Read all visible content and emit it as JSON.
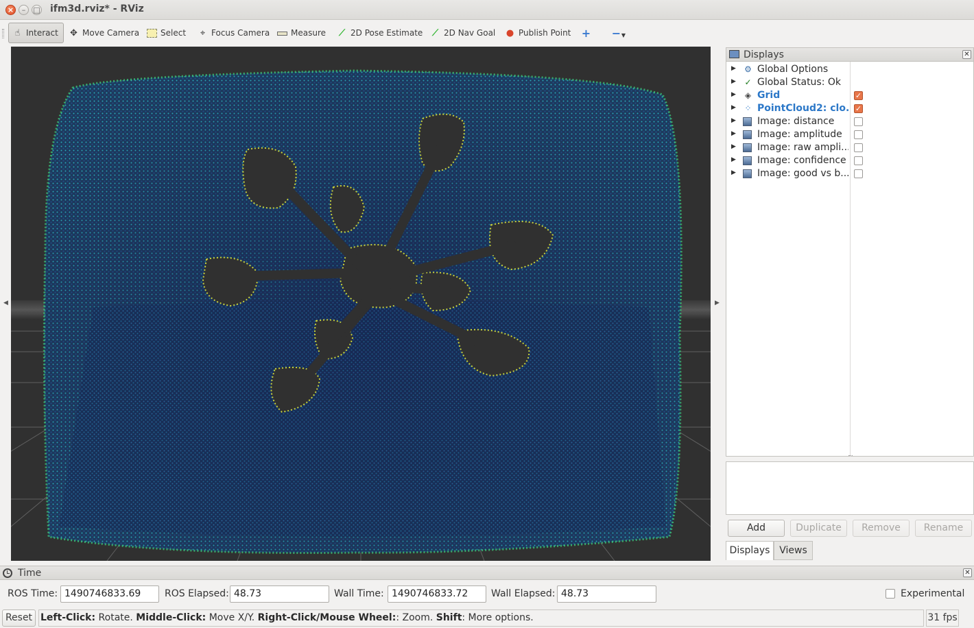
{
  "window": {
    "title": "ifm3d.rviz* - RViz"
  },
  "toolbar": {
    "interact": "Interact",
    "move_camera": "Move Camera",
    "select": "Select",
    "focus_camera": "Focus Camera",
    "measure": "Measure",
    "pose_estimate": "2D Pose Estimate",
    "nav_goal": "2D Nav Goal",
    "publish_point": "Publish Point"
  },
  "displays": {
    "title": "Displays",
    "items": [
      {
        "label": "Global Options",
        "icon": "gear-icon",
        "checked": null
      },
      {
        "label": "Global Status: Ok",
        "icon": "check-icon",
        "checked": null
      },
      {
        "label": "Grid",
        "icon": "grid-icon",
        "checked": true,
        "highlight": true
      },
      {
        "label": "PointCloud2: clo...",
        "icon": "pointcloud-icon",
        "checked": true,
        "highlight": true
      },
      {
        "label": "Image: distance",
        "icon": "image-icon",
        "checked": false
      },
      {
        "label": "Image: amplitude",
        "icon": "image-icon",
        "checked": false
      },
      {
        "label": "Image: raw ampli...",
        "icon": "image-icon",
        "checked": false
      },
      {
        "label": "Image: confidence",
        "icon": "image-icon",
        "checked": false
      },
      {
        "label": "Image: good vs b...",
        "icon": "image-icon",
        "checked": false
      }
    ],
    "buttons": {
      "add": "Add",
      "duplicate": "Duplicate",
      "remove": "Remove",
      "rename": "Rename"
    },
    "tabs": {
      "displays": "Displays",
      "views": "Views"
    }
  },
  "time": {
    "title": "Time",
    "ros_time_label": "ROS Time:",
    "ros_time": "1490746833.69",
    "ros_elapsed_label": "ROS Elapsed:",
    "ros_elapsed": "48.73",
    "wall_time_label": "Wall Time:",
    "wall_time": "1490746833.72",
    "wall_elapsed_label": "Wall Elapsed:",
    "wall_elapsed": "48.73",
    "experimental": "Experimental"
  },
  "status": {
    "reset": "Reset",
    "left_click_key": "Left-Click:",
    "left_click_val": " Rotate. ",
    "middle_click_key": "Middle-Click:",
    "middle_click_val": " Move X/Y. ",
    "right_click_key": "Right-Click/Mouse Wheel:",
    "right_click_val": ": Zoom. ",
    "shift_key": "Shift",
    "shift_val": ": More options.",
    "fps": "31 fps"
  },
  "colors": {
    "viewport_bg": "#303030",
    "accent_blue": "#2c78c8",
    "checkbox_on": "#e8764a"
  }
}
